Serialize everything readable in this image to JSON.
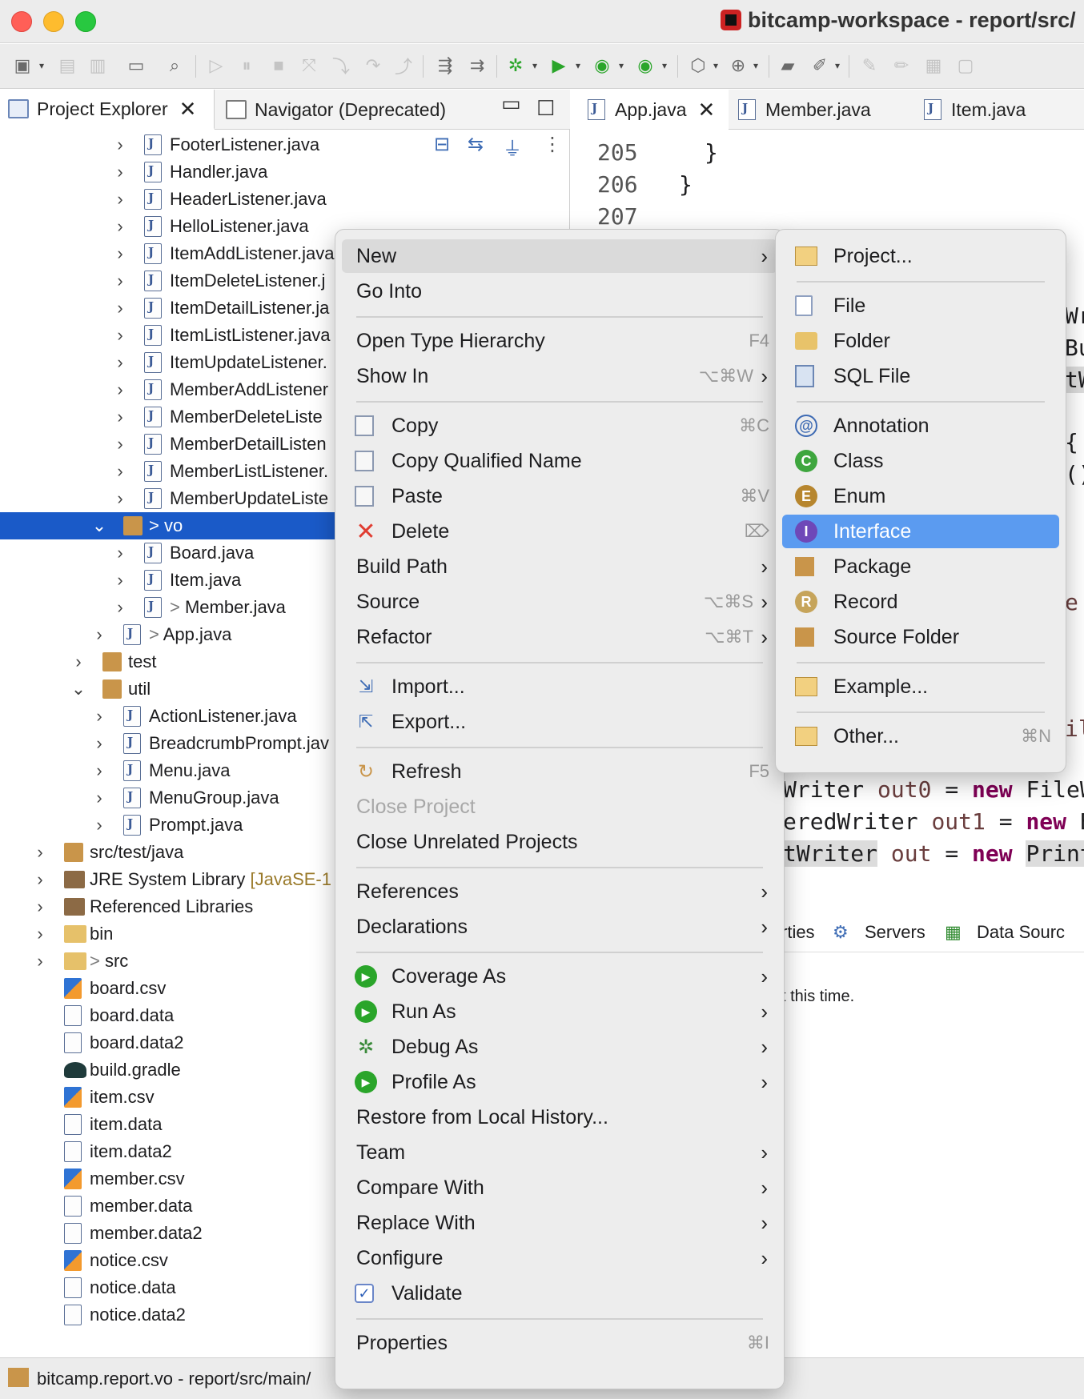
{
  "window": {
    "title": "bitcamp-workspace - report/src/"
  },
  "views": {
    "project_explorer": "Project Explorer",
    "navigator": "Navigator (Deprecated)"
  },
  "editor_tabs": [
    "App.java",
    "Member.java",
    "Item.java"
  ],
  "tree": [
    {
      "label": "FooterListener.java",
      "indent": 2,
      "icon": "java-file-icon"
    },
    {
      "label": "Handler.java",
      "indent": 2,
      "icon": "java-interface-file-icon"
    },
    {
      "label": "HeaderListener.java",
      "indent": 2,
      "icon": "java-file-icon"
    },
    {
      "label": "HelloListener.java",
      "indent": 2,
      "icon": "java-file-icon"
    },
    {
      "label": "ItemAddListener.java",
      "indent": 2,
      "icon": "java-file-icon"
    },
    {
      "label": "ItemDeleteListener.j",
      "indent": 2,
      "icon": "java-file-icon"
    },
    {
      "label": "ItemDetailListener.ja",
      "indent": 2,
      "icon": "java-file-icon"
    },
    {
      "label": "ItemListListener.java",
      "indent": 2,
      "icon": "java-file-icon"
    },
    {
      "label": "ItemUpdateListener.",
      "indent": 2,
      "icon": "java-file-icon"
    },
    {
      "label": "MemberAddListener",
      "indent": 2,
      "icon": "java-file-icon"
    },
    {
      "label": "MemberDeleteListe",
      "indent": 2,
      "icon": "java-file-icon"
    },
    {
      "label": "MemberDetailListen",
      "indent": 2,
      "icon": "java-file-icon"
    },
    {
      "label": "MemberListListener.",
      "indent": 2,
      "icon": "java-file-icon"
    },
    {
      "label": "MemberUpdateListe",
      "indent": 2,
      "icon": "java-file-icon"
    },
    {
      "label": "vo",
      "prefix": "> ",
      "indent": 1,
      "icon": "package-icon",
      "expanded": true,
      "selected": true
    },
    {
      "label": "Board.java",
      "indent": 2,
      "icon": "java-file-icon"
    },
    {
      "label": "Item.java",
      "indent": 2,
      "icon": "java-file-icon"
    },
    {
      "label": "Member.java",
      "prefix": "> ",
      "indent": 2,
      "icon": "java-file-icon"
    },
    {
      "label": "App.java",
      "prefix": "> ",
      "indent": 1,
      "icon": "java-file-icon"
    },
    {
      "label": "test",
      "indent": 0,
      "icon": "package-icon"
    },
    {
      "label": "util",
      "indent": 0,
      "icon": "package-icon",
      "expanded": true
    },
    {
      "label": "ActionListener.java",
      "indent": 1,
      "icon": "java-interface-file-icon"
    },
    {
      "label": "BreadcrumbPrompt.jav",
      "indent": 1,
      "icon": "java-file-icon"
    },
    {
      "label": "Menu.java",
      "indent": 1,
      "icon": "java-file-icon"
    },
    {
      "label": "MenuGroup.java",
      "indent": 1,
      "icon": "java-file-icon"
    },
    {
      "label": "Prompt.java",
      "indent": 1,
      "icon": "java-file-icon"
    },
    {
      "label": "src/test/java",
      "indent": -1,
      "icon": "source-folder-icon"
    },
    {
      "label": "JRE System Library",
      "extra": " [JavaSE-1",
      "indent": -1,
      "icon": "library-icon"
    },
    {
      "label": "Referenced Libraries",
      "indent": -1,
      "icon": "library-icon"
    },
    {
      "label": "bin",
      "indent": -1,
      "icon": "folder-icon"
    },
    {
      "label": "src",
      "prefix": "> ",
      "indent": -1,
      "icon": "folder-icon"
    },
    {
      "label": "board.csv",
      "indent": -1,
      "icon": "csv-file-icon",
      "leaf": true
    },
    {
      "label": "board.data",
      "indent": -1,
      "icon": "data-file-icon",
      "leaf": true
    },
    {
      "label": "board.data2",
      "indent": -1,
      "icon": "data-file-icon",
      "leaf": true
    },
    {
      "label": "build.gradle",
      "indent": -1,
      "icon": "gradle-icon",
      "leaf": true
    },
    {
      "label": "item.csv",
      "indent": -1,
      "icon": "csv-file-icon",
      "leaf": true
    },
    {
      "label": "item.data",
      "indent": -1,
      "icon": "data-file-icon",
      "leaf": true
    },
    {
      "label": "item.data2",
      "indent": -1,
      "icon": "data-file-icon",
      "leaf": true
    },
    {
      "label": "member.csv",
      "indent": -1,
      "icon": "csv-file-icon",
      "leaf": true
    },
    {
      "label": "member.data",
      "indent": -1,
      "icon": "data-file-icon",
      "leaf": true
    },
    {
      "label": "member.data2",
      "indent": -1,
      "icon": "data-file-icon",
      "leaf": true
    },
    {
      "label": "notice.csv",
      "indent": -1,
      "icon": "csv-file-icon",
      "leaf": true
    },
    {
      "label": "notice.data",
      "indent": -1,
      "icon": "data-file-icon",
      "leaf": true
    },
    {
      "label": "notice.data2",
      "indent": -1,
      "icon": "data-file-icon",
      "leaf": true
    }
  ],
  "editor": {
    "lines": [
      "205",
      "206",
      "207"
    ],
    "code": {
      "brace1": "}",
      "brace2": "}",
      "w1_type": "Writer",
      "w1_var": "out0",
      "w1_eq": "=",
      "w1_new": "new",
      "w1_rest": "FileWr",
      "w2_type": "eredWriter",
      "w2_var": "out1",
      "w2_eq": "=",
      "w2_new": "new",
      "w2_rest": "Bu",
      "w3_type": "tWriter",
      "w3_var": "out",
      "w3_eq": "=",
      "w3_new": "new",
      "w3_rest": "PrintW",
      "frag_wr": "Wr",
      "frag_bu": "Bu",
      "frag_tw": "tW",
      "frag_brace": "{",
      "frag_paren": "()",
      "frag_e": "e",
      "frag_il": "il"
    }
  },
  "bottom_panel": {
    "tabs": [
      "rties",
      "Servers",
      "Data Sourc"
    ],
    "message": "t this time."
  },
  "status": "bitcamp.report.vo - report/src/main/",
  "context_menu": [
    {
      "label": "New",
      "submenu": true,
      "hover": true
    },
    {
      "label": "Go Into"
    },
    {
      "sep": true
    },
    {
      "label": "Open Type Hierarchy",
      "shortcut": "F4"
    },
    {
      "label": "Show In",
      "shortcut": "⌥⌘W",
      "submenu": true
    },
    {
      "sep": true
    },
    {
      "label": "Copy",
      "shortcut": "⌘C",
      "icon": "copy-icon"
    },
    {
      "label": "Copy Qualified Name",
      "icon": "copy-qualified-name-icon"
    },
    {
      "label": "Paste",
      "shortcut": "⌘V",
      "icon": "paste-icon"
    },
    {
      "label": "Delete",
      "shortcut": "⌦",
      "icon": "delete-icon"
    },
    {
      "label": "Build Path",
      "submenu": true
    },
    {
      "label": "Source",
      "shortcut": "⌥⌘S",
      "submenu": true
    },
    {
      "label": "Refactor",
      "shortcut": "⌥⌘T",
      "submenu": true
    },
    {
      "sep": true
    },
    {
      "label": "Import...",
      "icon": "import-icon"
    },
    {
      "label": "Export...",
      "icon": "export-icon"
    },
    {
      "sep": true
    },
    {
      "label": "Refresh",
      "shortcut": "F5",
      "icon": "refresh-icon"
    },
    {
      "label": "Close Project",
      "disabled": true
    },
    {
      "label": "Close Unrelated Projects"
    },
    {
      "sep": true
    },
    {
      "label": "References",
      "submenu": true
    },
    {
      "label": "Declarations",
      "submenu": true
    },
    {
      "sep": true
    },
    {
      "label": "Coverage As",
      "submenu": true,
      "icon": "coverage-icon"
    },
    {
      "label": "Run As",
      "submenu": true,
      "icon": "run-icon"
    },
    {
      "label": "Debug As",
      "submenu": true,
      "icon": "debug-icon"
    },
    {
      "label": "Profile As",
      "submenu": true,
      "icon": "profile-icon"
    },
    {
      "label": "Restore from Local History..."
    },
    {
      "label": "Team",
      "submenu": true
    },
    {
      "label": "Compare With",
      "submenu": true
    },
    {
      "label": "Replace With",
      "submenu": true
    },
    {
      "label": "Configure",
      "submenu": true
    },
    {
      "label": "Validate",
      "icon": "checkbox-icon",
      "checked": true
    },
    {
      "sep": true
    },
    {
      "label": "Properties",
      "shortcut": "⌘I"
    }
  ],
  "submenu_new": [
    {
      "label": "Project...",
      "icon": "project-icon"
    },
    {
      "sep": true
    },
    {
      "label": "File",
      "icon": "file-icon"
    },
    {
      "label": "Folder",
      "icon": "folder-icon"
    },
    {
      "label": "SQL File",
      "icon": "sql-file-icon"
    },
    {
      "sep": true
    },
    {
      "label": "Annotation",
      "icon": "annotation-icon"
    },
    {
      "label": "Class",
      "icon": "class-icon"
    },
    {
      "label": "Enum",
      "icon": "enum-icon"
    },
    {
      "label": "Interface",
      "icon": "interface-icon",
      "highlighted": true
    },
    {
      "label": "Package",
      "icon": "package-icon"
    },
    {
      "label": "Record",
      "icon": "record-icon"
    },
    {
      "label": "Source Folder",
      "icon": "source-folder-icon"
    },
    {
      "sep": true
    },
    {
      "label": "Example...",
      "icon": "example-icon"
    },
    {
      "sep": true
    },
    {
      "label": "Other...",
      "shortcut": "⌘N",
      "icon": "other-icon"
    }
  ]
}
